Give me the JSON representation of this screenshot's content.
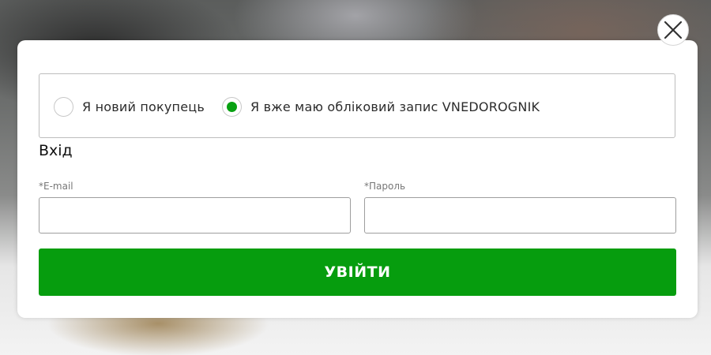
{
  "colors": {
    "accent": "#069d0e",
    "radio_selected": "#08a112",
    "modal_background": "#ffffff"
  },
  "close_button": {
    "icon": "close-icon"
  },
  "customer_type": {
    "options": [
      {
        "label": "Я новий покупець",
        "selected": false
      },
      {
        "label": "Я вже маю обліковий запис VNEDOROGNIK",
        "selected": true
      }
    ]
  },
  "login": {
    "title": "Вхід",
    "email_label": "*E-mail",
    "email_value": "",
    "password_label": "*Пароль",
    "password_value": "",
    "submit_label": "УВІЙТИ"
  }
}
